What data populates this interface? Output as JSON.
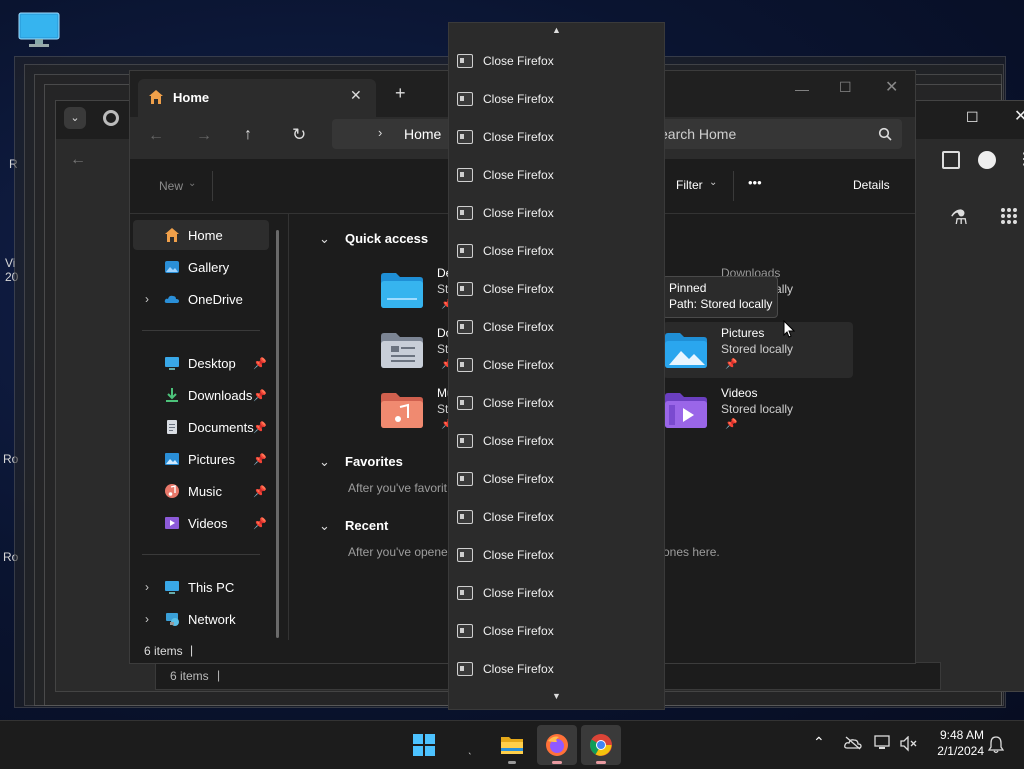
{
  "desktop": {
    "edge_labels": [
      "R",
      "Vi",
      "20",
      "Ro",
      "Ro"
    ]
  },
  "explorer": {
    "tab_title": "Home",
    "new_tab": "+",
    "path_crumb": "Home",
    "search_placeholder": "Search Home",
    "search_visible": "earch Home",
    "cmd": {
      "new": "New",
      "filter": "Filter",
      "more": "•••",
      "details": "Details"
    },
    "sidebar": {
      "home": "Home",
      "gallery": "Gallery",
      "onedrive": "OneDrive",
      "desktop": "Desktop",
      "downloads": "Downloads",
      "documents": "Documents",
      "pictures": "Pictures",
      "music": "Music",
      "videos": "Videos",
      "thispc": "This PC",
      "network": "Network"
    },
    "sections": {
      "quick_access": "Quick access",
      "favorites": "Favorites",
      "favorites_hint": "After you've favorit",
      "recent": "Recent",
      "recent_hint_left": "After you've opene",
      "recent_hint_right": "ones here."
    },
    "tiles": {
      "desktop_name": "De",
      "desktop_sub": "Sto",
      "documents_name": "Do",
      "documents_sub": "Sto",
      "music_name": "Mu",
      "music_sub": "Sto",
      "downloads_name": "Downloads",
      "downloads_sub": "Stored locally",
      "pictures_name": "Pictures",
      "pictures_sub": "Stored locally",
      "videos_name": "Videos",
      "videos_sub": "Stored locally"
    },
    "status": "6 items",
    "tooltip": {
      "line1": "Pinned",
      "line2": "Path: Stored locally"
    }
  },
  "behind_window": {
    "status": "6 items"
  },
  "jump_list": {
    "items": [
      "Close Firefox",
      "Close Firefox",
      "Close Firefox",
      "Close Firefox",
      "Close Firefox",
      "Close Firefox",
      "Close Firefox",
      "Close Firefox",
      "Close Firefox",
      "Close Firefox",
      "Close Firefox",
      "Close Firefox",
      "Close Firefox",
      "Close Firefox",
      "Close Firefox",
      "Close Firefox",
      "Close Firefox"
    ]
  },
  "taskbar": {
    "time": "9:48 AM",
    "date": "2/1/2024"
  }
}
